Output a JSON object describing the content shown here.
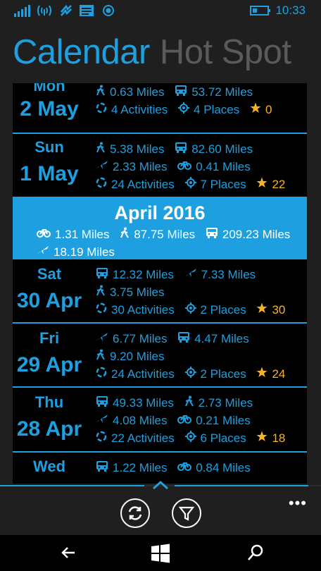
{
  "status_bar": {
    "time": "10:33",
    "icons": [
      "signal-icon",
      "wifi-icon",
      "data-icon",
      "message-icon",
      "location-icon",
      "battery-icon"
    ]
  },
  "pivot": {
    "active": "Calendar",
    "inactive": "Hot Spot"
  },
  "days": [
    {
      "dow": "Mon",
      "date": "2 May",
      "rows": [
        [
          {
            "icon": "walk-icon",
            "text": "0.63 Miles"
          },
          {
            "icon": "bus-icon",
            "text": "53.72 Miles"
          }
        ],
        [
          {
            "icon": "activities-icon",
            "text": "4 Activities"
          },
          {
            "icon": "places-icon",
            "text": "4 Places"
          },
          {
            "icon": "star-icon",
            "text": "0"
          }
        ]
      ]
    },
    {
      "dow": "Sun",
      "date": "1 May",
      "rows": [
        [
          {
            "icon": "walk-icon",
            "text": "5.38 Miles"
          },
          {
            "icon": "bus-icon",
            "text": "82.60 Miles"
          }
        ],
        [
          {
            "icon": "plane-icon",
            "text": "2.33 Miles"
          },
          {
            "icon": "bike-icon",
            "text": "0.41 Miles"
          }
        ],
        [
          {
            "icon": "activities-icon",
            "text": "24 Activities"
          },
          {
            "icon": "places-icon",
            "text": "7 Places"
          },
          {
            "icon": "star-icon",
            "text": "22"
          }
        ]
      ]
    },
    {
      "dow": "Sat",
      "date": "30 Apr",
      "rows": [
        [
          {
            "icon": "bus-icon",
            "text": "12.32 Miles"
          },
          {
            "icon": "plane-icon",
            "text": "7.33 Miles"
          }
        ],
        [
          {
            "icon": "walk-icon",
            "text": "3.75 Miles"
          }
        ],
        [
          {
            "icon": "activities-icon",
            "text": "30 Activities"
          },
          {
            "icon": "places-icon",
            "text": "2 Places"
          },
          {
            "icon": "star-icon",
            "text": "30"
          }
        ]
      ]
    },
    {
      "dow": "Fri",
      "date": "29 Apr",
      "rows": [
        [
          {
            "icon": "plane-icon",
            "text": "6.77 Miles"
          },
          {
            "icon": "bus-icon",
            "text": "4.47 Miles"
          }
        ],
        [
          {
            "icon": "walk-icon",
            "text": "9.20 Miles"
          }
        ],
        [
          {
            "icon": "activities-icon",
            "text": "24 Activities"
          },
          {
            "icon": "places-icon",
            "text": "2 Places"
          },
          {
            "icon": "star-icon",
            "text": "24"
          }
        ]
      ]
    },
    {
      "dow": "Thu",
      "date": "28 Apr",
      "rows": [
        [
          {
            "icon": "bus-icon",
            "text": "49.33 Miles"
          },
          {
            "icon": "walk-icon",
            "text": "2.73 Miles"
          }
        ],
        [
          {
            "icon": "plane-icon",
            "text": "4.08 Miles"
          },
          {
            "icon": "bike-icon",
            "text": "0.21 Miles"
          }
        ],
        [
          {
            "icon": "activities-icon",
            "text": "22 Activities"
          },
          {
            "icon": "places-icon",
            "text": "6 Places"
          },
          {
            "icon": "star-icon",
            "text": "18"
          }
        ]
      ]
    },
    {
      "dow": "Wed",
      "date": "",
      "rows": [
        [
          {
            "icon": "bus-icon",
            "text": "1.22 Miles"
          },
          {
            "icon": "bike-icon",
            "text": "0.84 Miles"
          }
        ]
      ]
    }
  ],
  "month_summary": {
    "title": "April 2016",
    "rows": [
      [
        {
          "icon": "bike-icon",
          "text": "1.31 Miles"
        },
        {
          "icon": "walk-icon",
          "text": "87.75 Miles"
        },
        {
          "icon": "bus-icon",
          "text": "209.23 Miles"
        }
      ],
      [
        {
          "icon": "plane-icon",
          "text": "18.19 Miles"
        }
      ]
    ]
  },
  "app_bar": {
    "buttons": [
      "refresh-icon",
      "filter-icon"
    ],
    "more": "•••"
  },
  "nav_bar": {
    "icons": [
      "back-icon",
      "windows-icon",
      "search-icon"
    ]
  },
  "colors": {
    "accent": "#1ea0e0",
    "star": "#f5b324",
    "background": "#000000",
    "chrome": "#1f1f1f"
  }
}
